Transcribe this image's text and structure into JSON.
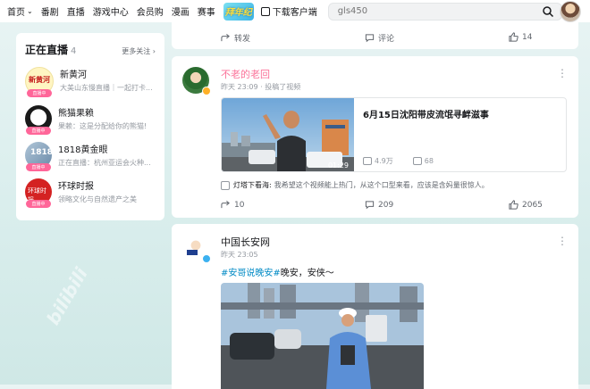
{
  "header": {
    "nav": [
      "首页",
      "番剧",
      "直播",
      "游戏中心",
      "会员购",
      "漫画",
      "赛事"
    ],
    "mascot_text": "拜年纪",
    "download_label": "下载客户端",
    "search_placeholder": "gls450"
  },
  "live": {
    "title": "正在直播",
    "count": "4",
    "more": "更多关注",
    "badge": "直播中",
    "items": [
      {
        "name": "新黄河",
        "desc": "大美山东慢直播｜一起打卡..."
      },
      {
        "name": "熊猫果赖",
        "desc": "果赖：这是分配给你的熊猫!"
      },
      {
        "name": "1818黄金眼",
        "desc": "正在直播：杭州亚运会火种..."
      },
      {
        "name": "环球时报",
        "desc": "领略文化与自然遗产之美"
      }
    ]
  },
  "top_card": {
    "forward": "转发",
    "comment": "评论",
    "like": "14"
  },
  "post1": {
    "name": "不老的老回",
    "meta": "昨天 23:09 · 投稿了视频",
    "video_title": "6月15日沈阳带皮流氓寻衅滋事",
    "duration": "01:29",
    "views": "4.9万",
    "danmaku": "68",
    "top_comment_user": "灯塔下看海:",
    "top_comment_text": "我希望这个视频能上热门，从这个口型来看，应该是含妈量很惊人。",
    "forward": "10",
    "comment": "209",
    "like": "2065"
  },
  "post2": {
    "name": "中国长安网",
    "meta": "昨天 23:05",
    "tag": "#安哥说晚安#",
    "text": "晚安，安侠～"
  },
  "colors": {
    "accent": "#008ac5",
    "pink": "#ff6699",
    "name_pink": "#fb7299"
  }
}
